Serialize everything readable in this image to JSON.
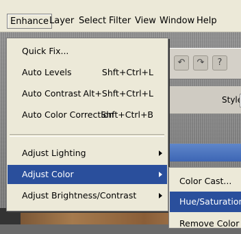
{
  "menubar": {
    "items": [
      {
        "label": "Enhance",
        "active": true
      },
      {
        "label": "Layer"
      },
      {
        "label": "Select"
      },
      {
        "label": "Filter"
      },
      {
        "label": "View"
      },
      {
        "label": "Window"
      },
      {
        "label": "Help"
      }
    ]
  },
  "enhance_menu": {
    "items": [
      {
        "label": "Quick Fix...",
        "shortcut": ""
      },
      {
        "label": "Auto Levels",
        "shortcut": "Shft+Ctrl+L"
      },
      {
        "label": "Auto Contrast",
        "shortcut": "Alt+Shft+Ctrl+L"
      },
      {
        "label": "Auto Color Correction",
        "shortcut": "Shft+Ctrl+B"
      },
      {
        "label": "Adjust Lighting",
        "shortcut": "",
        "submenu": true
      },
      {
        "label": "Adjust Color",
        "shortcut": "",
        "submenu": true,
        "highlighted": true
      },
      {
        "label": "Adjust Brightness/Contrast",
        "shortcut": "",
        "submenu": true
      }
    ]
  },
  "adjust_color_submenu": {
    "items": [
      {
        "label": "Color Cast..."
      },
      {
        "label": "Hue/Saturation...",
        "highlighted": true
      },
      {
        "label": "Remove Color"
      }
    ]
  },
  "options_bar": {
    "style_label": "Style:"
  },
  "colors": {
    "menu_bg": "#ece9d8",
    "highlight": "#2a4f9c"
  }
}
